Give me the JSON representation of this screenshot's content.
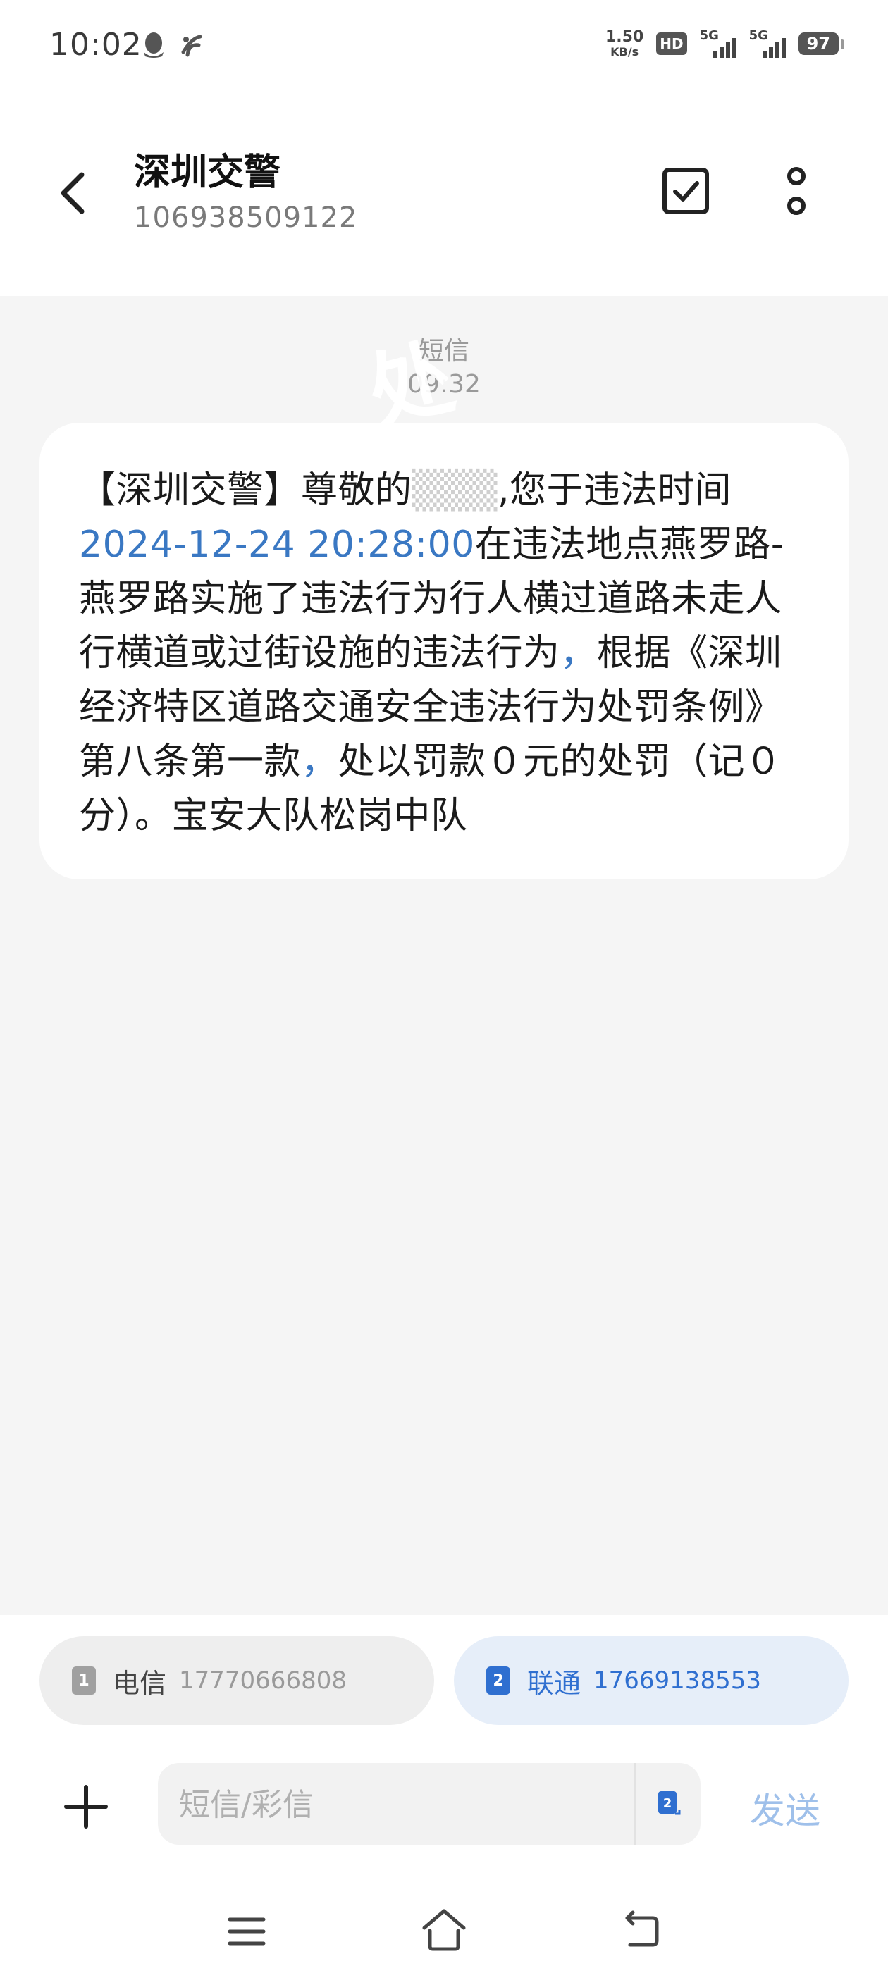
{
  "status_bar": {
    "time": "10:02",
    "net_speed": "1.50",
    "net_speed_unit": "KB/s",
    "hd_label": "HD",
    "sim1_network": "5G",
    "sim2_network": "5G",
    "battery": "97",
    "left_icons": [
      "qq-icon",
      "telecom-icon"
    ]
  },
  "header": {
    "contact_name": "深圳交警",
    "contact_number": "106938509122",
    "icons": {
      "back": "back-arrow-icon",
      "select": "checkbox-select-icon",
      "more": "more-vertical-icon"
    }
  },
  "conversation": {
    "message_type_label": "短信",
    "message_time": "09:32",
    "watermark_text": "处",
    "message": {
      "part1": "【深圳交警】尊敬的",
      "part2": ",您于违法时间",
      "datetime": "2024-12-24 20:28:00",
      "part3": "在违法地点燕罗路-燕罗路实施了违法行为行人横过道路未走人行横道或过街设施的违法行为",
      "comma1": "，",
      "part4": "根据《深圳经济特区道路交通安全违法行为处罚条例》第八条第一款",
      "comma2": "，",
      "part5": "处以罚款０元的处罚（记０分）。宝安大队松岗中队"
    }
  },
  "bottom": {
    "sim1": {
      "slot": "1",
      "carrier": "电信",
      "number": "17770666808"
    },
    "sim2": {
      "slot": "2",
      "carrier": "联通",
      "number": "17669138553"
    },
    "compose": {
      "placeholder": "短信/彩信",
      "value": "",
      "send_label": "发送",
      "sim_switch_slot": "2"
    }
  },
  "colors": {
    "link": "#3a78c3",
    "sim2_accent": "#2f6fd0",
    "send_disabled": "#9fc0ea",
    "background": "#f5f5f5"
  }
}
